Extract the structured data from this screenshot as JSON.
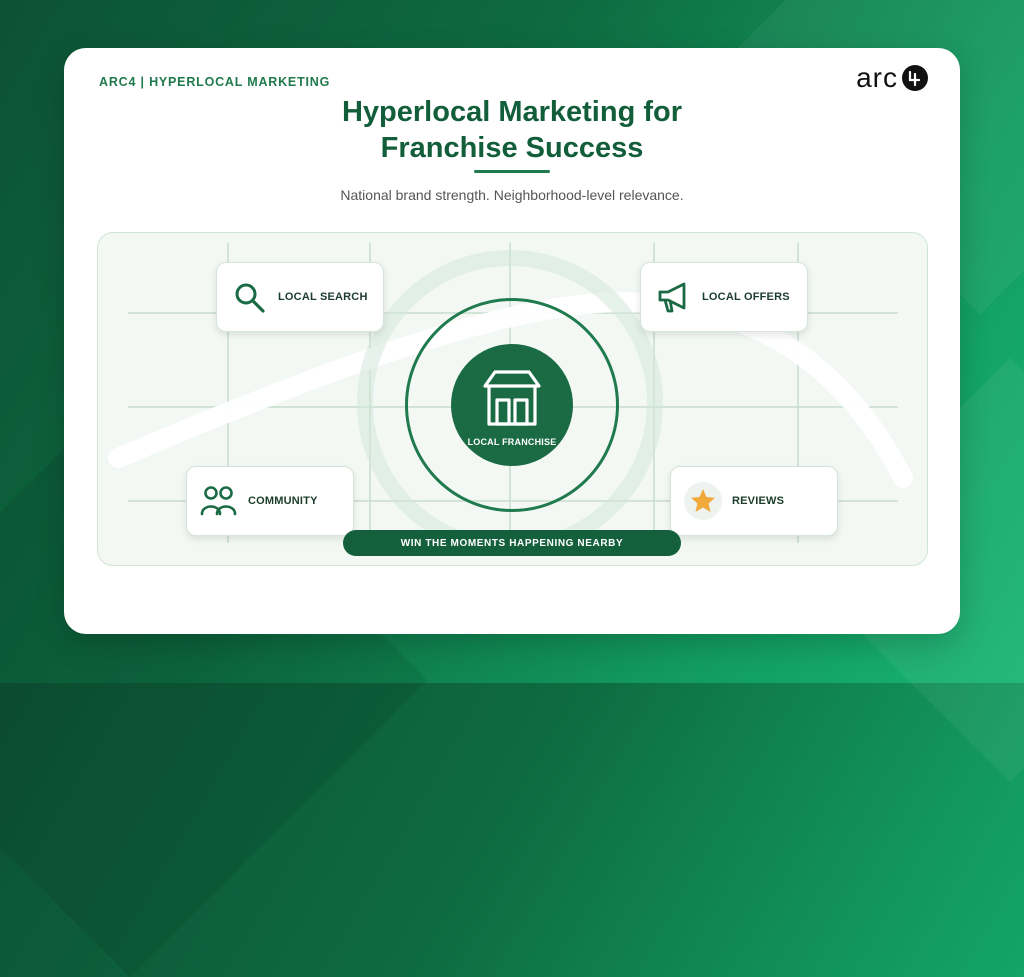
{
  "colors": {
    "brand_green": "#1a6b44",
    "accent_star": "#f2a93b",
    "text_dark": "#1b3c2b"
  },
  "header": {
    "tag": "ARC4 | HYPERLOCAL MARKETING",
    "logo_text": "arc",
    "title": "Hyperlocal Marketing for\nFranchise Success",
    "subtitle": "National brand strength. Neighborhood-level relevance."
  },
  "features": {
    "search": {
      "label": "LOCAL SEARCH",
      "icon": "search-icon"
    },
    "offers": {
      "label": "LOCAL OFFERS",
      "icon": "megaphone-icon"
    },
    "community": {
      "label": "COMMUNITY",
      "icon": "people-icon"
    },
    "reviews": {
      "label": "REVIEWS",
      "icon": "star-icon"
    }
  },
  "center": {
    "label": "LOCAL FRANCHISE",
    "icon": "storefront-icon"
  },
  "banner": {
    "text": "WIN THE MOMENTS HAPPENING NEARBY"
  }
}
